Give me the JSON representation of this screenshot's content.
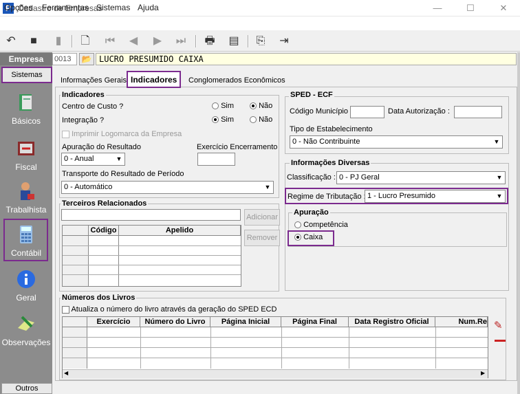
{
  "window": {
    "title": "Cadastro de Empresas",
    "minimize": "—",
    "maximize": "☐",
    "close": "✕"
  },
  "menu": [
    "Opções",
    "Ferramentas",
    "Sistemas",
    "Ajuda"
  ],
  "toolbar": {
    "icons": [
      "undo-icon",
      "save-icon",
      "save-as-icon",
      "print-preview-icon",
      "first-icon",
      "previous-icon",
      "next-icon",
      "last-icon",
      "print-icon",
      "report-icon",
      "copy-icon",
      "exit-icon"
    ]
  },
  "sidebar": {
    "empresa_label": "Empresa",
    "sistemas": "Sistemas",
    "items": [
      {
        "label": "Básicos",
        "icon": "books-icon"
      },
      {
        "label": "Fiscal",
        "icon": "fiscal-book-icon"
      },
      {
        "label": "Trabalhista",
        "icon": "worker-icon"
      },
      {
        "label": "Contábil",
        "icon": "calculator-icon"
      },
      {
        "label": "Geral",
        "icon": "info-icon"
      },
      {
        "label": "Observações",
        "icon": "notes-icon"
      }
    ],
    "outros": "Outros"
  },
  "empresa": {
    "code": "0013",
    "name": "LUCRO PRESUMIDO CAIXA"
  },
  "tabs": [
    "Informações Gerais",
    "Indicadores",
    "Conglomerados Econômicos"
  ],
  "indicadores": {
    "title": "Indicadores",
    "centro_custo": "Centro de Custo ?",
    "integracao": "Integração ?",
    "sim": "Sim",
    "nao": "Não",
    "imprimir_logomarca": "Imprimir Logomarca da Empresa",
    "apuracao_resultado": "Apuração do Resultado",
    "apuracao_value": "0 - Anual",
    "exercicio_encerramento": "Exercício Encerramento",
    "exercicio_value": "",
    "transporte": "Transporte do Resultado de Período",
    "transporte_value": "0 - Automático"
  },
  "terceiros": {
    "title": "Terceiros Relacionados",
    "input_value": "",
    "adicionar": "Adicionar",
    "remover": "Remover",
    "columns": [
      "Código",
      "Apelido"
    ]
  },
  "sped": {
    "title": "SPED - ECF",
    "codigo_municipio": "Código Município :",
    "codigo_value": "",
    "data_autorizacao": "Data Autorização :",
    "data_value": "",
    "tipo_estabelecimento": "Tipo de Estabelecimento",
    "tipo_value": "0 - Não Contribuinte"
  },
  "info_diversas": {
    "title": "Informações Diversas",
    "classificacao": "Classificação :",
    "classificacao_value": "0 - PJ Geral",
    "regime": "Regime de Tributação :",
    "regime_value": "1 - Lucro Presumido"
  },
  "apuracao": {
    "title": "Apuração",
    "competencia": "Competência",
    "caixa": "Caixa"
  },
  "livros": {
    "title": "Números dos Livros",
    "atualiza": "Atualiza o número do livro através da geração do SPED ECD",
    "columns": [
      "Exercício",
      "Número do Livro",
      "Página Inicial",
      "Página Final",
      "Data Registro Oficial",
      "Num.Re"
    ]
  }
}
